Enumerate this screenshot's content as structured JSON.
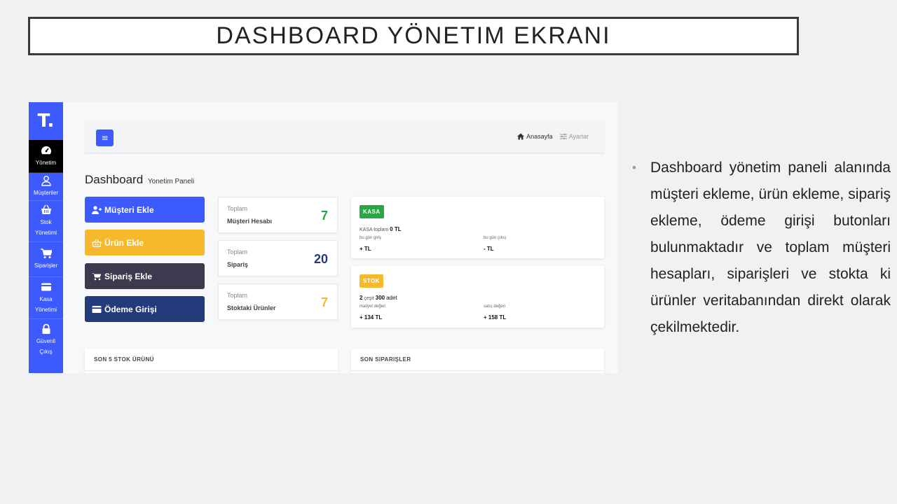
{
  "slide": {
    "title": "DASHBOARD YÖNETIM EKRANI",
    "description": "Dashboard yönetim paneli alanında müşteri ekleme, ürün ekleme, sipariş ekleme, ödeme girişi butonları bulunmaktadır ve toplam müşteri hesapları, siparişleri ve stokta ki ürünler veritabanından direkt olarak çekilmektedir.",
    "bullet": "•"
  },
  "app": {
    "logo": "T.",
    "colors": {
      "primary": "#3d5afe",
      "sidebar_active": "#000000",
      "green": "#28a745",
      "yellow": "#f6b92b",
      "dark": "#3b3a4e",
      "navy": "#233a7b"
    },
    "sidebar": [
      {
        "label": "Yönetim",
        "icon": "gauge-icon",
        "active": true
      },
      {
        "label": "Müşteriler",
        "icon": "user-icon"
      },
      {
        "label": "Stok Yönetimi",
        "icon": "basket-icon"
      },
      {
        "label": "Siparişler",
        "icon": "cart-icon"
      },
      {
        "label": "Kasa Yönetimi",
        "icon": "card-icon"
      },
      {
        "label": "Güvenli Çıkış",
        "icon": "lock-icon"
      }
    ],
    "topbar": {
      "menu_icon": "≡",
      "home_label": "Anasayfa",
      "settings_label": "Ayarlar"
    },
    "page_title": "Dashboard",
    "page_subtitle": "Yonetim Paneli",
    "actions": [
      {
        "label": "Müşteri Ekle",
        "icon": "user-plus-icon",
        "color": "#3d5afe"
      },
      {
        "label": "Ürün Ekle",
        "icon": "basket-icon",
        "color": "#f6b92b"
      },
      {
        "label": "Sipariş Ekle",
        "icon": "cart-icon",
        "color": "#3b3a4e"
      },
      {
        "label": "Ödeme Girişi",
        "icon": "card-icon",
        "color": "#233a7b"
      }
    ],
    "stats": [
      {
        "label": "Toplam",
        "name": "Müşteri Hesabı",
        "value": "7",
        "color": "#28a745"
      },
      {
        "label": "Toplam",
        "name": "Sipariş",
        "value": "20",
        "color": "#233a7b"
      },
      {
        "label": "Toplam",
        "name": "Stoktaki Ürünler",
        "value": "7",
        "color": "#f6b92b"
      }
    ],
    "kasa": {
      "badge": "KASA",
      "total_label": "KASA toplam",
      "total_value": "0 TL",
      "in_label": "bu gün giriş",
      "out_label": "bu gün çıkış",
      "in_value": "+ TL",
      "out_value": "- TL"
    },
    "stok": {
      "badge": "STOK",
      "count": "2",
      "count_unit": "çeşit",
      "qty": "300",
      "qty_unit": "adet",
      "cost_label": "maliyet değeri",
      "sale_label": "satış değeri",
      "cost_value": "+ 134 TL",
      "sale_value": "+ 158 TL"
    },
    "panels": {
      "left": "SON 5 STOK ÜRÜNÜ",
      "right": "SON SIPARIŞLER"
    }
  }
}
